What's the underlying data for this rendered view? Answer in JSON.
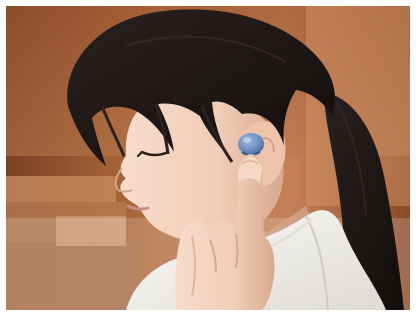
{
  "image": {
    "subject": "earbud-touch-gesture-photo",
    "palette": {
      "wall_warm": "#b4703f",
      "wall_shadow": "#6e3b1f",
      "wall_light": "#d9a37a",
      "shelf_wood": "#c89064",
      "hair": "#1a1413",
      "skin": "#f2d2bf",
      "skin_shadow": "#dfb29a",
      "shirt": "#f4f3f1",
      "earbud": "#6f8fc4",
      "earbud_tip": "#4e6ea4",
      "lips": "#c98d80"
    }
  }
}
